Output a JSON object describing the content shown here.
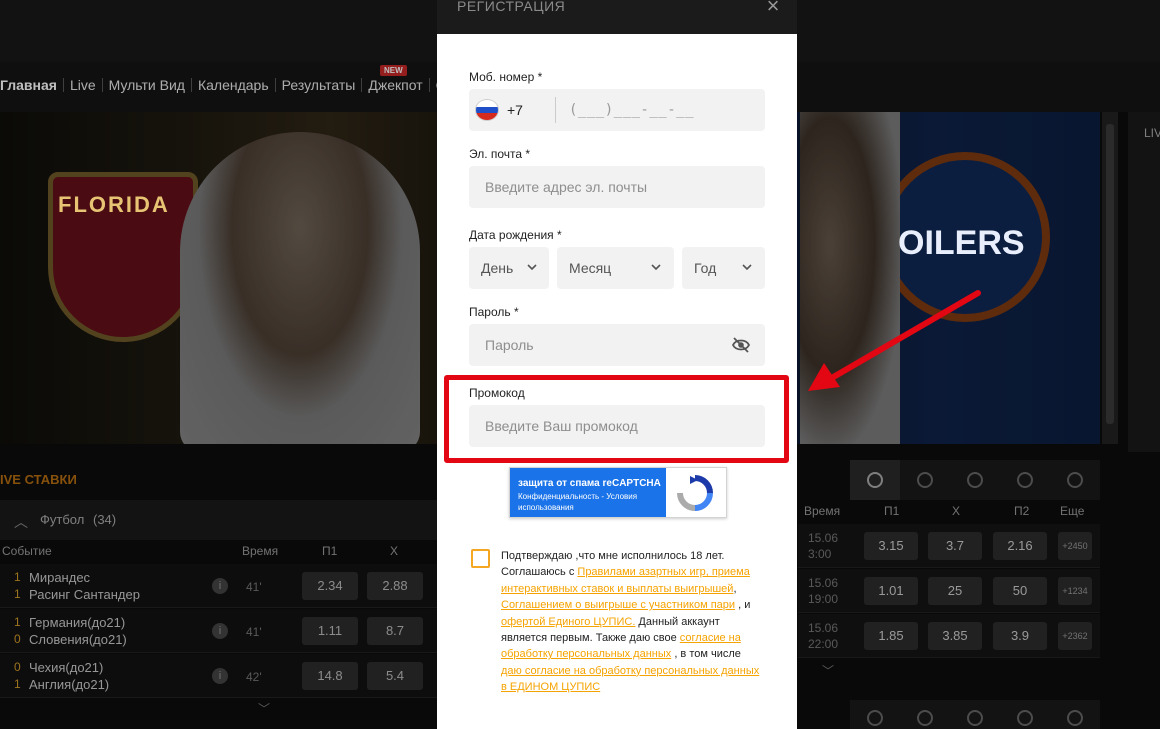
{
  "nav": {
    "items": [
      "Главная",
      "Live",
      "Мульти Вид",
      "Календарь",
      "Результаты",
      "Джекпот",
      "С"
    ],
    "new_badge": "NEW"
  },
  "banner": {
    "left_team_text": "FLORIDA",
    "right_team_text": "OILERS",
    "right_panel_label": "LIV"
  },
  "live": {
    "title": "IVE СТАВКИ",
    "sport": "Футбол",
    "sport_count": "(34)",
    "columns": [
      "Событие",
      "Время",
      "П1",
      "Х"
    ],
    "matches": [
      {
        "score1": "1",
        "team1": "Мирандес",
        "score2": "1",
        "team2": "Расинг Сантандер",
        "time": "41'",
        "p1": "2.34",
        "x": "2.88"
      },
      {
        "score1": "1",
        "team1": "Германия(до21)",
        "score2": "0",
        "team2": "Словения(до21)",
        "time": "41'",
        "p1": "1.11",
        "x": "8.7"
      },
      {
        "score1": "0",
        "team1": "Чехия(до21)",
        "score2": "1",
        "team2": "Англия(до21)",
        "time": "42'",
        "p1": "14.8",
        "x": "5.4"
      }
    ]
  },
  "upcoming": {
    "columns": [
      "Время",
      "П1",
      "Х",
      "П2",
      "Еще"
    ],
    "rows": [
      {
        "date": "15.06",
        "time": "3:00",
        "p1": "3.15",
        "x": "3.7",
        "p2": "2.16",
        "more": "+2450"
      },
      {
        "date": "15.06",
        "time": "19:00",
        "p1": "1.01",
        "x": "25",
        "p2": "50",
        "more": "+1234"
      },
      {
        "date": "15.06",
        "time": "22:00",
        "p1": "1.85",
        "x": "3.85",
        "p2": "3.9",
        "more": "+2362"
      }
    ]
  },
  "modal": {
    "title": "РЕГИСТРАЦИЯ",
    "close": "×",
    "phone": {
      "label": "Моб. номер *",
      "code": "+7",
      "mask": "(___)___-__-__"
    },
    "email": {
      "label": "Эл. почта *",
      "placeholder": "Введите адрес эл. почты"
    },
    "dob": {
      "label": "Дата рождения *",
      "day": "День",
      "month": "Месяц",
      "year": "Год"
    },
    "password": {
      "label": "Пароль *",
      "placeholder": "Пароль"
    },
    "promo": {
      "label": "Промокод",
      "placeholder": "Введите Ваш промокод"
    },
    "captcha": {
      "title": "защита от спама reCAPTCHA",
      "links": "Конфиденциальность - Условия использования"
    },
    "consent": {
      "t1": "Подтверждаю ,что мне исполнилось 18 лет. Соглашаюсь с ",
      "l1": "Правилами азартных игр, приема интерактивных ставок и выплаты выигрышей",
      "t2": ", ",
      "l2": "Соглашением о выигрыше с участником пари",
      "t3": " , и ",
      "l3": "офертой Единого ЦУПИС.",
      "t4": " Данный аккаунт является первым. Также даю свое ",
      "l4": "согласие на обработку персональных данных",
      "t5": " , в том числе ",
      "l5": "даю согласие на обработку персональных данных в ЕДИНОМ ЦУПИС"
    }
  },
  "colors": {
    "accent": "#f5a300",
    "highlight": "#e30613",
    "captcha_blue": "#1a73e8"
  }
}
